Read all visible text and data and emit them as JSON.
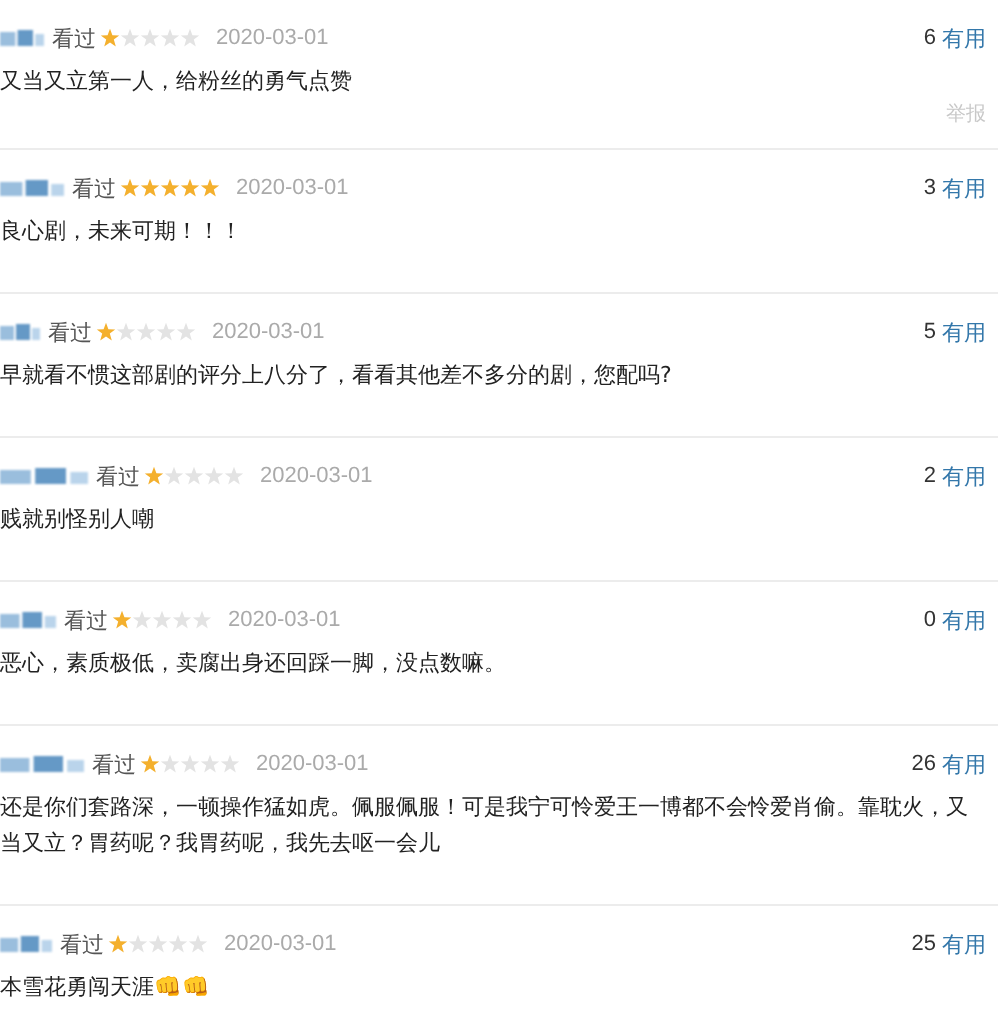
{
  "reviews": [
    {
      "status": "看过",
      "stars": 1,
      "date": "2020-03-01",
      "votes": "6",
      "vote_label": "有用",
      "comment": "又当又立第一人，给粉丝的勇气点赞",
      "report": "举报"
    },
    {
      "status": "看过",
      "stars": 5,
      "date": "2020-03-01",
      "votes": "3",
      "vote_label": "有用",
      "comment": "良心剧，未来可期！！！"
    },
    {
      "status": "看过",
      "stars": 1,
      "date": "2020-03-01",
      "votes": "5",
      "vote_label": "有用",
      "comment": "早就看不惯这部剧的评分上八分了，看看其他差不多分的剧，您配吗?"
    },
    {
      "status": "看过",
      "stars": 1,
      "date": "2020-03-01",
      "votes": "2",
      "vote_label": "有用",
      "comment": "贱就别怪别人嘲"
    },
    {
      "status": "看过",
      "stars": 1,
      "date": "2020-03-01",
      "votes": "0",
      "vote_label": "有用",
      "comment": "恶心，素质极低，卖腐出身还回踩一脚，没点数嘛。"
    },
    {
      "status": "看过",
      "stars": 1,
      "date": "2020-03-01",
      "votes": "26",
      "vote_label": "有用",
      "comment": "还是你们套路深，一顿操作猛如虎。佩服佩服！可是我宁可怜爱王一博都不会怜爱肖偷。靠耽火，又当又立？胃药呢？我胃药呢，我先去呕一会儿"
    },
    {
      "status": "看过",
      "stars": 1,
      "date": "2020-03-01",
      "votes": "25",
      "vote_label": "有用",
      "comment": "本雪花勇闯天涯👊👊"
    }
  ]
}
